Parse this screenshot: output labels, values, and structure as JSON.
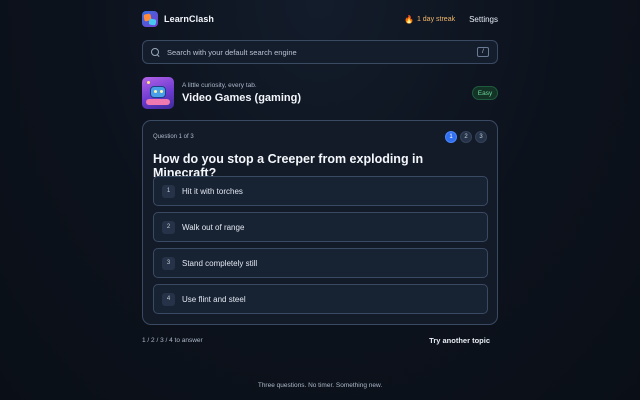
{
  "header": {
    "brand": "LearnClash",
    "streak_icon": "fire-icon",
    "streak": "1 day streak",
    "settings": "Settings"
  },
  "search": {
    "placeholder": "Search with your default search engine",
    "shortcut": "/"
  },
  "topic": {
    "tagline": "A little curiosity, every tab.",
    "title": "Video Games (gaming)",
    "difficulty": "Easy"
  },
  "quiz": {
    "counter": "Question 1 of 3",
    "steps": [
      "1",
      "2",
      "3"
    ],
    "active_step": 1,
    "question": "How do you stop a Creeper from exploding in Minecraft?",
    "options": [
      {
        "num": "1",
        "label": "Hit it with torches"
      },
      {
        "num": "2",
        "label": "Walk out of range"
      },
      {
        "num": "3",
        "label": "Stand completely still"
      },
      {
        "num": "4",
        "label": "Use flint and steel"
      }
    ]
  },
  "footer": {
    "hint": "1 / 2 / 3 / 4 to answer",
    "try_another": "Try another topic",
    "tagline": "Three questions. No timer. Something new."
  },
  "colors": {
    "accent": "#2f6ff0",
    "background": "#0c121c",
    "easy_badge": "#6fd49a",
    "streak": "#f2b76a"
  }
}
